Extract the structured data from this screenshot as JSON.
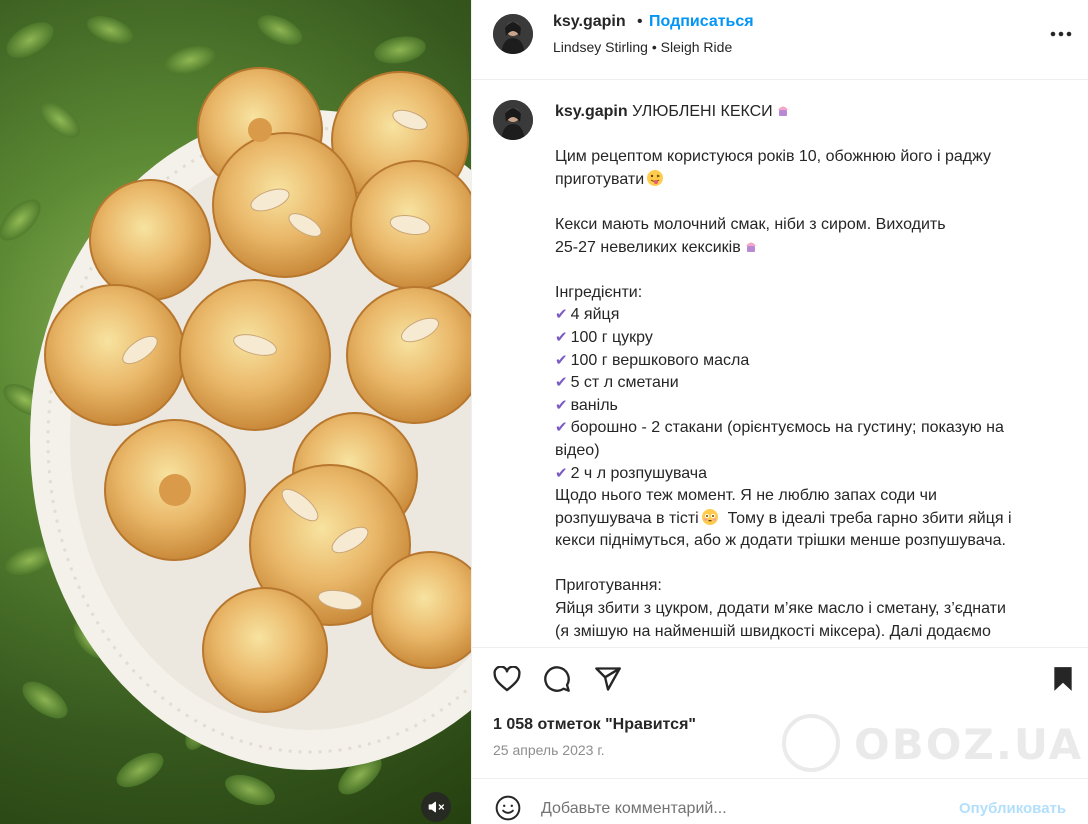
{
  "post": {
    "username": "ksy.gapin",
    "separator": "•",
    "follow_label": "Подписаться",
    "audio": {
      "artist": "Lindsey Stirling",
      "separator": "•",
      "track": "Sleigh Ride"
    }
  },
  "caption": {
    "username": "ksy.gapin",
    "title": "УЛЮБЛЕНІ КЕКСИ",
    "paragraph1": [
      "Цим рецептом користуюся років 10, обожнюю його і раджу",
      "приготувати"
    ],
    "paragraph2": [
      "Кекси мають молочний смак, ніби з сиром. Виходить",
      "25-27 невеликих кексиків"
    ],
    "ingredients_header": "Інгредієнти:",
    "check_mark": "✔",
    "ingredients": [
      "4 яйця",
      "100 г цукру",
      "100 г вершкового масла",
      "5 ст л сметани",
      "ваніль",
      "борошно - 2 стакани (орієнтуємось на густину; показую на",
      "2 ч л розпушувача"
    ],
    "ingredient_continuation": "відео)",
    "note": [
      "Щодо нього теж момент. Я не люблю запах соди чи",
      "розпушувача в тісті",
      "Тому в ідеалі треба гарно збити яйця і",
      "кекси піднімуться, або ж додати трішки менше розпушувача."
    ],
    "prep_header": "Приготування:",
    "prep": [
      "Яйця збити з цукром, додати м’яке масло і сметану, з’єднати",
      "(я змішую на найменшій швидкості міксера). Далі додаємо"
    ]
  },
  "engagement": {
    "likes_text": "1 058 отметок \"Нравится\"",
    "date": "25 апрель 2023 г."
  },
  "watermark": {
    "text": "OBOZ.UA"
  },
  "comment": {
    "placeholder": "Добавьте комментарий...",
    "publish_label": "Опубликовать"
  },
  "colors": {
    "link_blue": "#0095f6",
    "publish_disabled": "#b2dffc",
    "check_purple": "#7b5cc4",
    "secondary_text": "#8e8e8e"
  },
  "icons": [
    "more-icon",
    "heart-icon",
    "comment-icon",
    "share-icon",
    "bookmark-icon",
    "emoji-icon",
    "mute-icon"
  ]
}
